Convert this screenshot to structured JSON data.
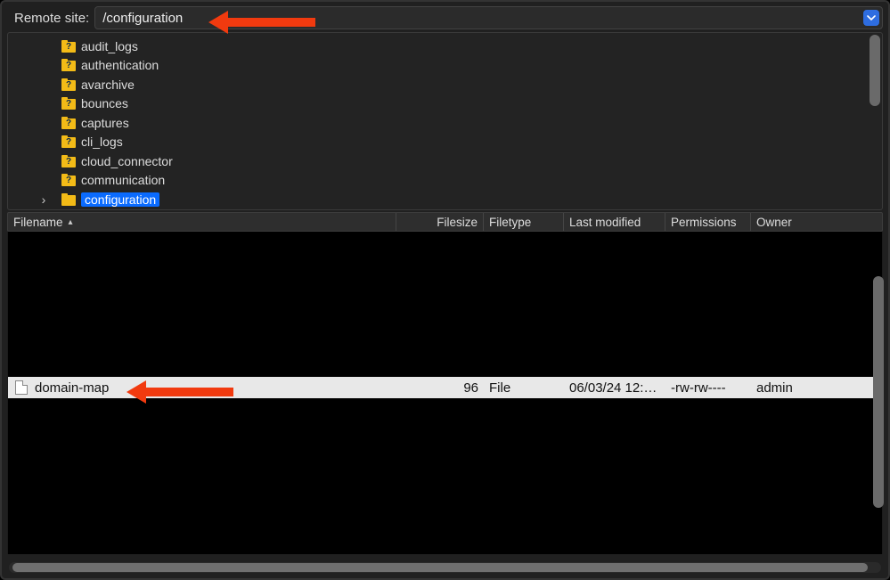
{
  "addressBar": {
    "label": "Remote site:",
    "path": "/configuration"
  },
  "tree": {
    "items": [
      {
        "label": "audit_logs",
        "unknown": true,
        "selected": false,
        "expander": ""
      },
      {
        "label": "authentication",
        "unknown": true,
        "selected": false,
        "expander": ""
      },
      {
        "label": "avarchive",
        "unknown": true,
        "selected": false,
        "expander": ""
      },
      {
        "label": "bounces",
        "unknown": true,
        "selected": false,
        "expander": ""
      },
      {
        "label": "captures",
        "unknown": true,
        "selected": false,
        "expander": ""
      },
      {
        "label": "cli_logs",
        "unknown": true,
        "selected": false,
        "expander": ""
      },
      {
        "label": "cloud_connector",
        "unknown": true,
        "selected": false,
        "expander": ""
      },
      {
        "label": "communication",
        "unknown": true,
        "selected": false,
        "expander": ""
      },
      {
        "label": "configuration",
        "unknown": false,
        "selected": true,
        "expander": "›"
      }
    ]
  },
  "columns": {
    "filename": "Filename",
    "filesize": "Filesize",
    "filetype": "Filetype",
    "lastmod": "Last modified",
    "perms": "Permissions",
    "owner": "Owner",
    "sort_indicator": "▴"
  },
  "listing": {
    "parent_entry": "..",
    "rows": [
      {
        "name": "domain-map",
        "size": "96",
        "type": "File",
        "modified": "06/03/24 12:…",
        "permissions": "-rw-rw----",
        "owner": "admin",
        "selected": true
      }
    ]
  }
}
